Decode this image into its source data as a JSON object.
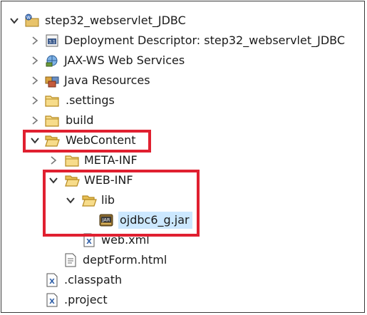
{
  "tree": {
    "project": {
      "label": "step32_webservlet_JDBC",
      "icon": "project-folder-icon"
    },
    "items": [
      {
        "label": "Deployment Descriptor: step32_webservlet_JDBC",
        "icon": "deployment-descriptor-icon"
      },
      {
        "label": "JAX-WS Web Services",
        "icon": "web-services-icon"
      },
      {
        "label": "Java Resources",
        "icon": "java-resources-icon"
      },
      {
        "label": ".settings",
        "icon": "folder-icon"
      },
      {
        "label": "build",
        "icon": "folder-icon"
      },
      {
        "label": "WebContent",
        "icon": "open-folder-icon"
      },
      {
        "label": "META-INF",
        "icon": "folder-icon"
      },
      {
        "label": "WEB-INF",
        "icon": "open-folder-icon"
      },
      {
        "label": "lib",
        "icon": "open-folder-icon"
      },
      {
        "label": "ojdbc6_g.jar",
        "icon": "jar-icon"
      },
      {
        "label": "web.xml",
        "icon": "xml-file-icon"
      },
      {
        "label": "deptForm.html",
        "icon": "html-file-icon"
      },
      {
        "label": ".classpath",
        "icon": "xml-file-icon"
      },
      {
        "label": ".project",
        "icon": "xml-file-icon"
      }
    ]
  },
  "colors": {
    "highlight_border": "#e02030",
    "selection": "#cce8ff"
  }
}
